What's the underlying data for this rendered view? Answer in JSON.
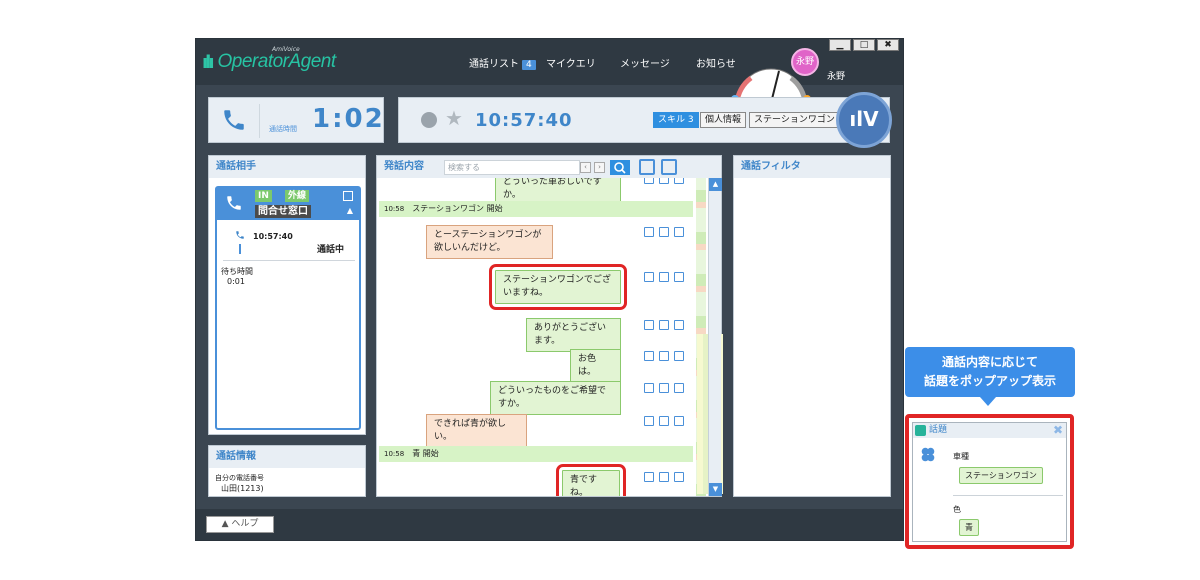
{
  "app": {
    "logo_small": "AmiVoice",
    "logo_text": "OperatorAgent",
    "menu": {
      "call_list": "通話リスト",
      "call_list_count": "4",
      "my_query": "マイクエリ",
      "message": "メッセージ",
      "notice": "お知らせ"
    },
    "window_buttons": [
      "▁",
      "□",
      "✖"
    ],
    "user": {
      "avatar_text": "永野",
      "name": "永野"
    }
  },
  "status": {
    "call_time_label": "通話時間",
    "call_time_value": "1:02",
    "clock": "10:57:40",
    "tags": [
      "スキル 3",
      "個人情報",
      "ステーションワゴン"
    ]
  },
  "left": {
    "title": "通話相手",
    "caller": {
      "tag_in": "IN",
      "tag_ext": "外線",
      "dept": "問合せ窓口",
      "time": "10:57:40",
      "status": "通話中",
      "wait_label": "待ち時間",
      "wait_value": "0:01"
    },
    "info": {
      "title": "通話情報",
      "label": "自分の電話番号",
      "value": "山田(1213)"
    }
  },
  "middle": {
    "title": "発話内容",
    "search_placeholder": "検索する",
    "messages": [
      {
        "type": "op",
        "text": "どういった車おしいですか。"
      },
      {
        "type": "topic",
        "time": "10:58",
        "text": "ステーションワゴン 開始"
      },
      {
        "type": "cu",
        "text": "とーステーションワゴンが欲しいんだけど。"
      },
      {
        "type": "op",
        "text": "ステーションワゴンでございますね。"
      },
      {
        "type": "op",
        "text": "ありがとうございます。"
      },
      {
        "type": "op",
        "text": "お色は。"
      },
      {
        "type": "op",
        "text": "どういったものをご希望ですか。"
      },
      {
        "type": "cu",
        "text": "できれば青が欲しい。"
      },
      {
        "type": "topic",
        "time": "10:58",
        "text": "青 開始"
      },
      {
        "type": "op",
        "text": "青ですね。"
      }
    ]
  },
  "right": {
    "title": "通話フィルタ"
  },
  "bottom": {
    "help": "ヘルプ"
  },
  "callout": {
    "line1": "通話内容に応じて",
    "line2": "話題をポップアップ表示"
  },
  "popup": {
    "title": "話題",
    "car_label": "車種",
    "car_value": "ステーションワゴン",
    "color_label": "色",
    "color_value": "青"
  },
  "colors": {
    "accent": "#3f86c9",
    "highlight": "#e02525",
    "operator_bubble": "#e2f4d3",
    "customer_bubble": "#fbe4d3"
  }
}
